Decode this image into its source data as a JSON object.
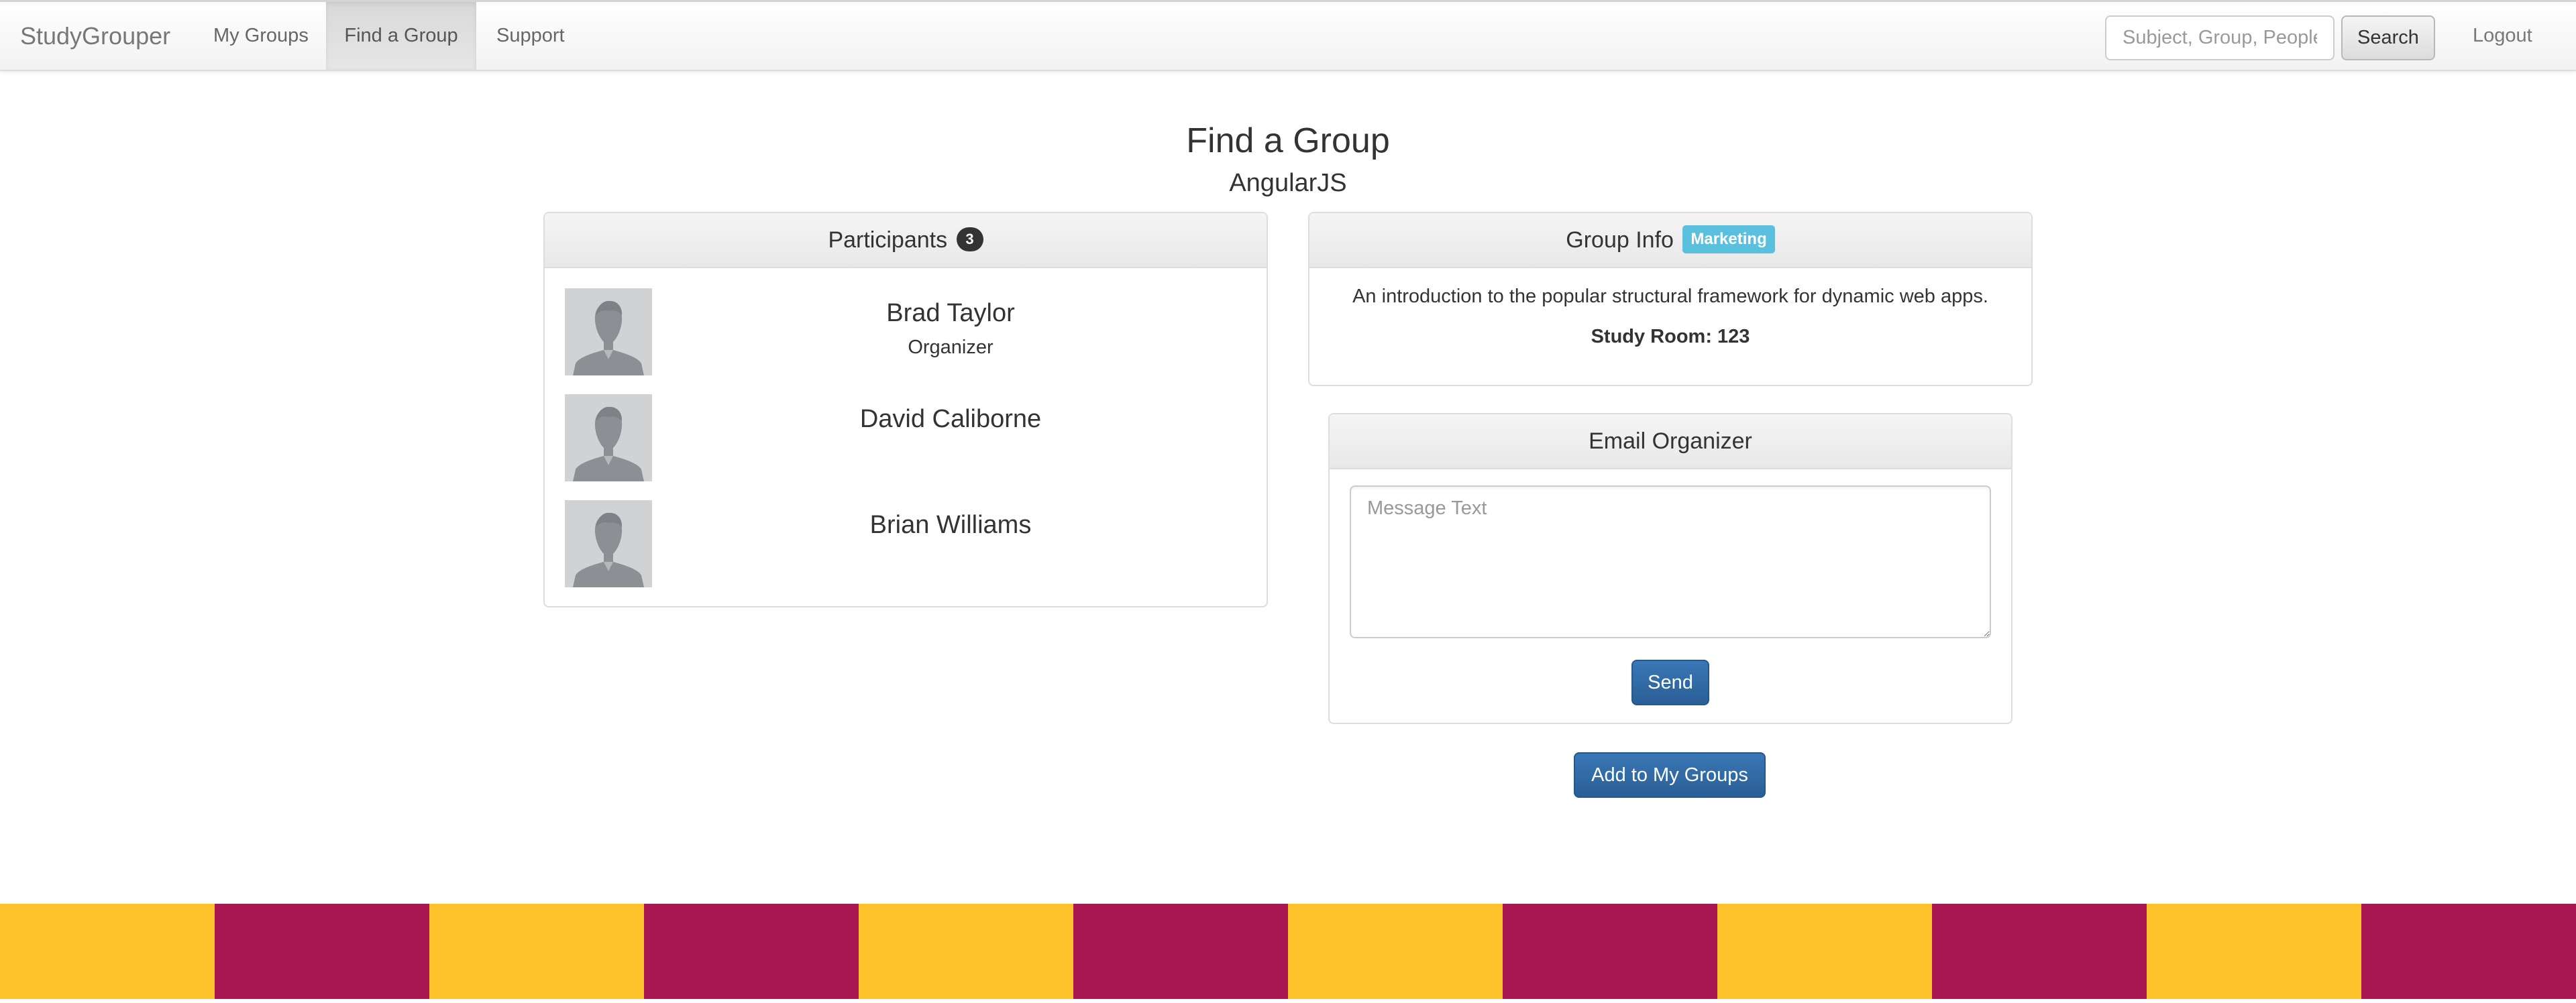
{
  "navbar": {
    "brand": "StudyGrouper",
    "items": [
      {
        "label": "My Groups",
        "active": false
      },
      {
        "label": "Find a Group",
        "active": true
      },
      {
        "label": "Support",
        "active": false
      }
    ],
    "search": {
      "placeholder": "Subject, Group, People",
      "value": "",
      "button_label": "Search"
    },
    "logout_label": "Logout"
  },
  "page": {
    "title": "Find a Group",
    "subtitle": "AngularJS"
  },
  "participants_panel": {
    "heading": "Participants",
    "count": "3",
    "participants": [
      {
        "name": "Brad Taylor",
        "role": "Organizer",
        "avatar_icon": "person-silhouette-icon"
      },
      {
        "name": "David Caliborne",
        "role": "",
        "avatar_icon": "person-silhouette-icon"
      },
      {
        "name": "Brian Williams",
        "role": "",
        "avatar_icon": "person-silhouette-icon"
      }
    ]
  },
  "group_info_panel": {
    "heading": "Group Info",
    "tag": "Marketing",
    "description": "An introduction to the popular structural framework for dynamic web apps.",
    "room": "Study Room: 123"
  },
  "email_panel": {
    "heading": "Email Organizer",
    "message_placeholder": "Message Text",
    "message_value": "",
    "send_label": "Send"
  },
  "add_button_label": "Add to My Groups",
  "colors": {
    "primary_button": "#2e6da4",
    "tag_info": "#5bc0de",
    "stripe_gold": "#fec22b",
    "stripe_maroon": "#a91652"
  },
  "footer_stripes": [
    "gold",
    "maroon",
    "gold",
    "maroon",
    "gold",
    "maroon",
    "gold",
    "maroon",
    "gold",
    "maroon",
    "gold",
    "maroon"
  ]
}
